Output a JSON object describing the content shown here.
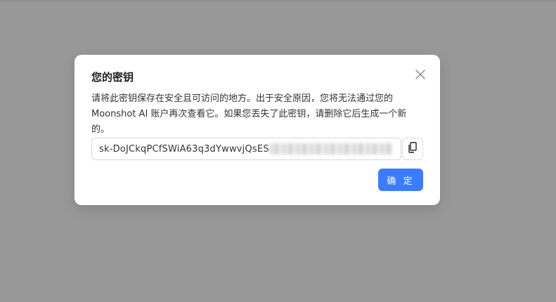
{
  "modal": {
    "title": "您的密钥",
    "description": "请将此密钥保存在安全且可访问的地方。出于安全原因，您将无法通过您的 Moonshot AI 账户再次查看它。如果您丢失了此密钥，请删除它后生成一个新的。",
    "api_key_visible": "sk-DoJCkqPCfSWiA63q3dYwwvjQsES",
    "confirm_label": "确 定"
  },
  "icons": {
    "close": "close-icon",
    "copy": "copy-icon"
  },
  "colors": {
    "overlay": "#989898",
    "primary": "#3b7cff",
    "border": "#d9d9d9"
  }
}
